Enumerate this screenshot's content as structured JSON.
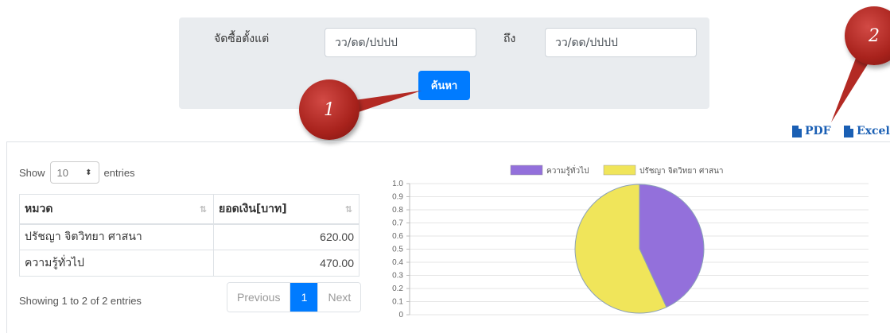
{
  "filter": {
    "from_label": "จัดซื้อตั้งแต่",
    "to_label": "ถึง",
    "from_placeholder": "วว/ดด/ปปปป",
    "to_placeholder": "วว/ดด/ปปปป",
    "search_label": "ค้นหา"
  },
  "callouts": {
    "one": "1",
    "two": "2"
  },
  "export": {
    "pdf_label": "PDF",
    "excel_label": "Excel"
  },
  "table_controls": {
    "show_label": "Show",
    "entries_value": "10",
    "entries_label": "entries",
    "info": "Showing 1 to 2 of 2 entries"
  },
  "table": {
    "headers": [
      "หมวด",
      "ยอดเงิน[บาท]"
    ],
    "rows": [
      [
        "ปรัชญา จิตวิทยา ศาสนา",
        "620.00"
      ],
      [
        "ความรู้ทั่วไป",
        "470.00"
      ]
    ]
  },
  "pagination": {
    "previous": "Previous",
    "current": "1",
    "next": "Next"
  },
  "chart_data": {
    "type": "pie",
    "legend_position": "top",
    "labels": [
      "ความรู้ทั่วไป",
      "ปรัชญา จิตวิทยา ศาสนา"
    ],
    "values": [
      470,
      620
    ],
    "colors": [
      "#9370db",
      "#f0e55a"
    ],
    "y_ticks": [
      "1.0",
      "0.9",
      "0.8",
      "0.7",
      "0.6",
      "0.5",
      "0.4",
      "0.3",
      "0.2",
      "0.1",
      "0"
    ],
    "grid": true
  }
}
